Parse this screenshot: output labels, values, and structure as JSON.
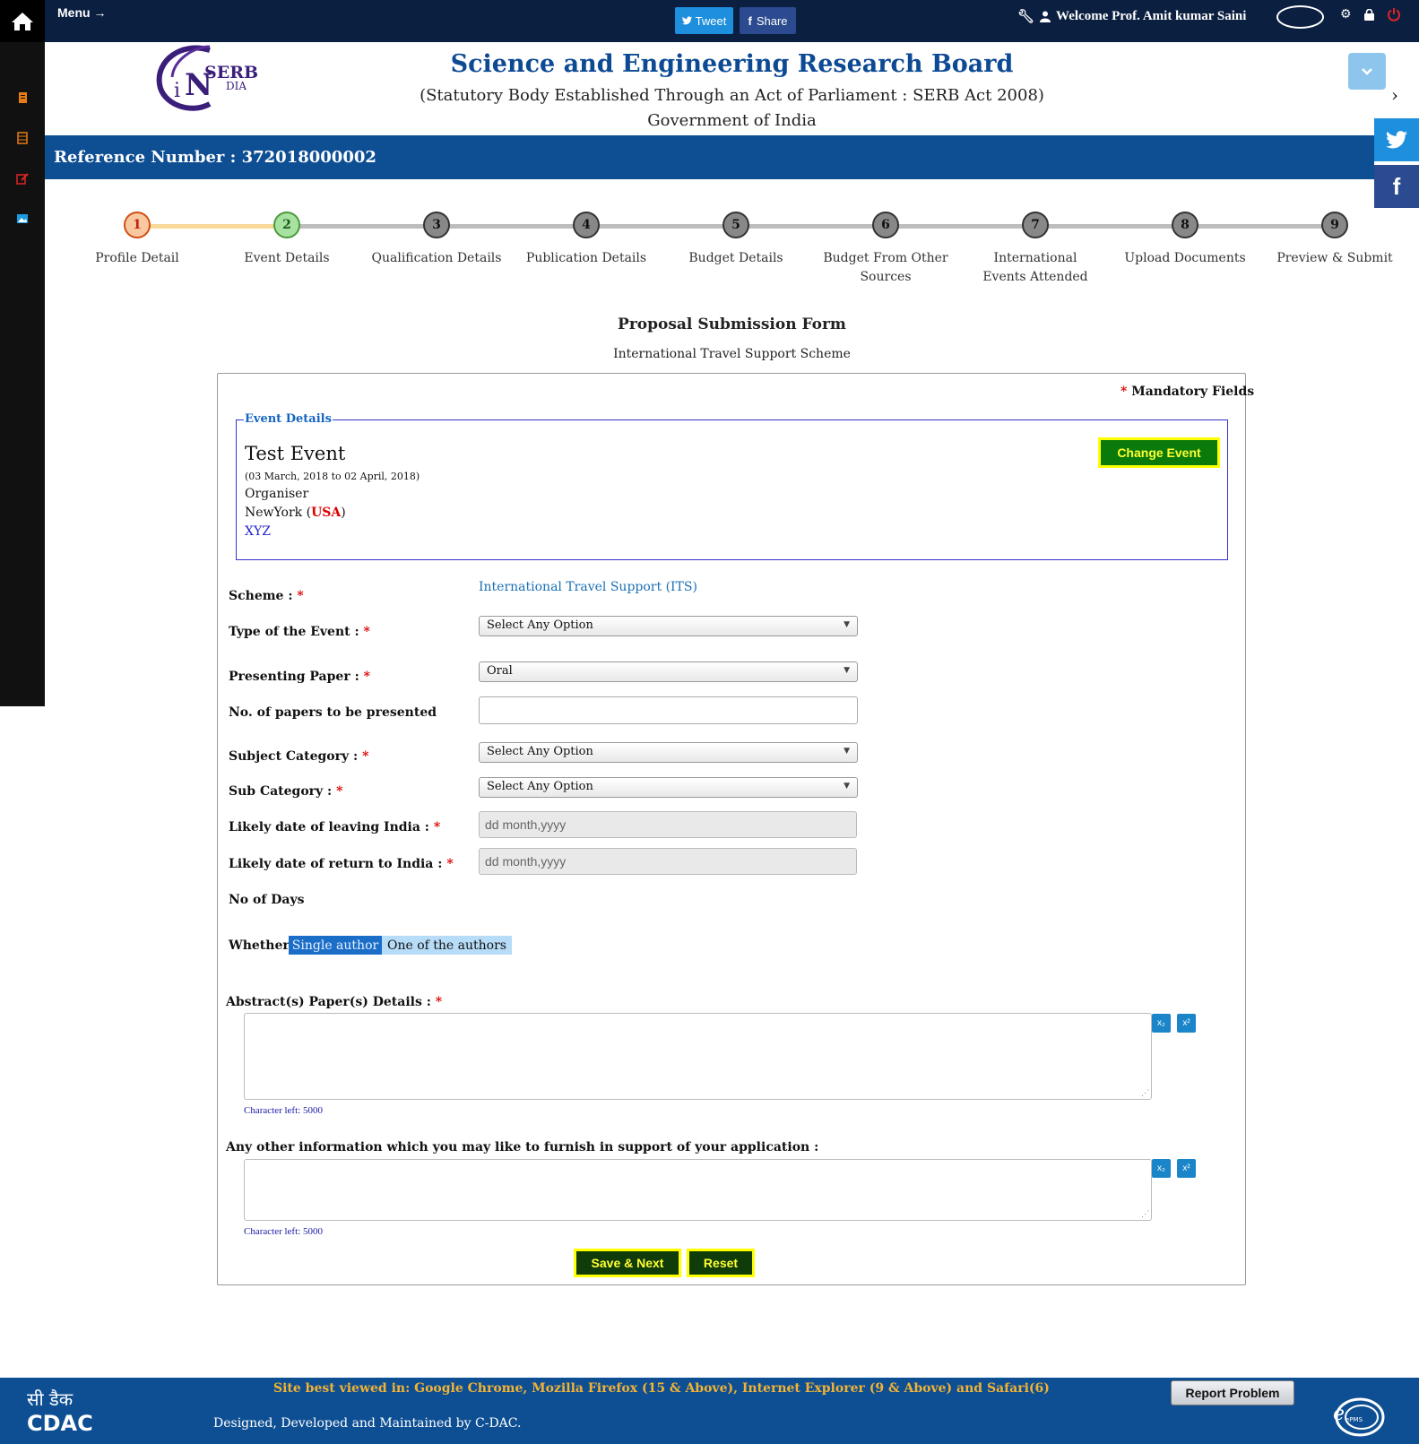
{
  "topbar": {
    "menu_label": "Menu",
    "tweet_label": "Tweet",
    "share_label": "Share",
    "welcome": "Welcome Prof. Amit kumar Saini"
  },
  "header": {
    "logo_text": "SERB",
    "logo_sub": "DIA",
    "title": "Science and Engineering Research Board",
    "subtitle": "(Statutory Body Established Through an Act of Parliament : SERB Act 2008)",
    "government": "Government of India"
  },
  "reference": "Reference Number : 372018000002",
  "steps": [
    {
      "num": "1",
      "label": "Profile Detail",
      "state": "done"
    },
    {
      "num": "2",
      "label": "Event Details",
      "state": "current"
    },
    {
      "num": "3",
      "label": "Qualification Details",
      "state": "pending"
    },
    {
      "num": "4",
      "label": "Publication Details",
      "state": "pending"
    },
    {
      "num": "5",
      "label": "Budget Details",
      "state": "pending"
    },
    {
      "num": "6",
      "label": "Budget From Other Sources",
      "state": "pending"
    },
    {
      "num": "7",
      "label": "International Events Attended",
      "state": "pending"
    },
    {
      "num": "8",
      "label": "Upload Documents",
      "state": "pending"
    },
    {
      "num": "9",
      "label": "Preview & Submit",
      "state": "pending"
    }
  ],
  "form": {
    "title": "Proposal Submission Form",
    "subtitle": "International Travel Support Scheme",
    "mandatory_star": "*",
    "mandatory_label": "Mandatory Fields"
  },
  "event": {
    "legend": "Event Details",
    "name": "Test Event",
    "dates": "(03 March, 2018 to 02 April, 2018)",
    "organiser": "Organiser",
    "city": "NewYork",
    "country": "USA",
    "extra": "XYZ",
    "change_label": "Change Event"
  },
  "fields": {
    "scheme_label": "Scheme :",
    "scheme_value": "International Travel Support (ITS)",
    "event_type_label": "Type of the Event :",
    "event_type_value": "Select Any Option",
    "presenting_label": "Presenting Paper :",
    "presenting_value": "Oral",
    "papers_label": "No. of papers to be presented",
    "papers_value": "",
    "subject_label": "Subject Category :",
    "subject_value": "Select Any Option",
    "subcat_label": "Sub Category :",
    "subcat_value": "Select Any Option",
    "leave_label": "Likely date of leaving India :",
    "leave_placeholder": "dd month,yyyy",
    "return_label": "Likely date of return to India :",
    "return_placeholder": "dd month,yyyy",
    "days_label": "No of Days",
    "whether_label": "Whether",
    "author_options": [
      "Single author",
      "One of the authors"
    ],
    "author_selected": "Single author",
    "abstract_label": "Abstract(s) Paper(s) Details :",
    "abstract_charleft": "Character left: 5000",
    "other_label": "Any other information which you may like to furnish in support of your application :",
    "other_charleft": "Character left: 5000",
    "subscript_btn": "x₂",
    "superscript_btn": "x²",
    "required_star": "*"
  },
  "actions": {
    "save_label": "Save & Next",
    "reset_label": "Reset"
  },
  "footer": {
    "best_viewed": "Site best viewed in: Google Chrome, Mozilla Firefox (15 & Above), Internet Explorer (9 & Above) and Safari(6)",
    "designed": "Designed, Developed and Maintained by C-DAC.",
    "report_label": "Report Problem",
    "cdac_hindi": "सी डैक",
    "cdac": "CDAC",
    "epms": "ePMS"
  },
  "colors": {
    "topbar": "#0b1f40",
    "brand_blue": "#0e4f94",
    "title_blue": "#0d4a94",
    "step_done": "#f8c9a0",
    "step_current": "#a8e2a0",
    "button_green": "#0a7a0a",
    "button_text": "#ffff33",
    "footer_yellow": "#f2b233"
  }
}
